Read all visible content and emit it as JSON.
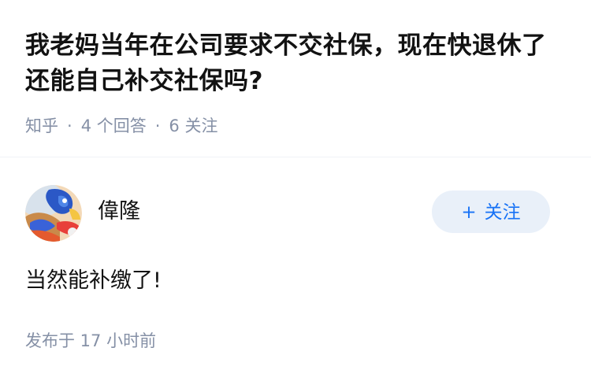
{
  "question": {
    "title": "我老妈当年在公司要求不交社保，现在快退休了还能自己补交社保吗?",
    "source": "知乎",
    "answer_count": "4 个回答",
    "follower_count": "6 关注",
    "separator": "·"
  },
  "answer": {
    "author_name": "偉隆",
    "follow_label": "关注",
    "follow_plus": "+",
    "content": "当然能补缴了!",
    "time_label": "发布于 17 小时前"
  },
  "colors": {
    "accent": "#1772f6",
    "meta_gray": "#8590a6",
    "text": "#121212",
    "button_bg": "#e9f0f9"
  },
  "icons": {
    "avatar": "user-avatar-illustration"
  }
}
